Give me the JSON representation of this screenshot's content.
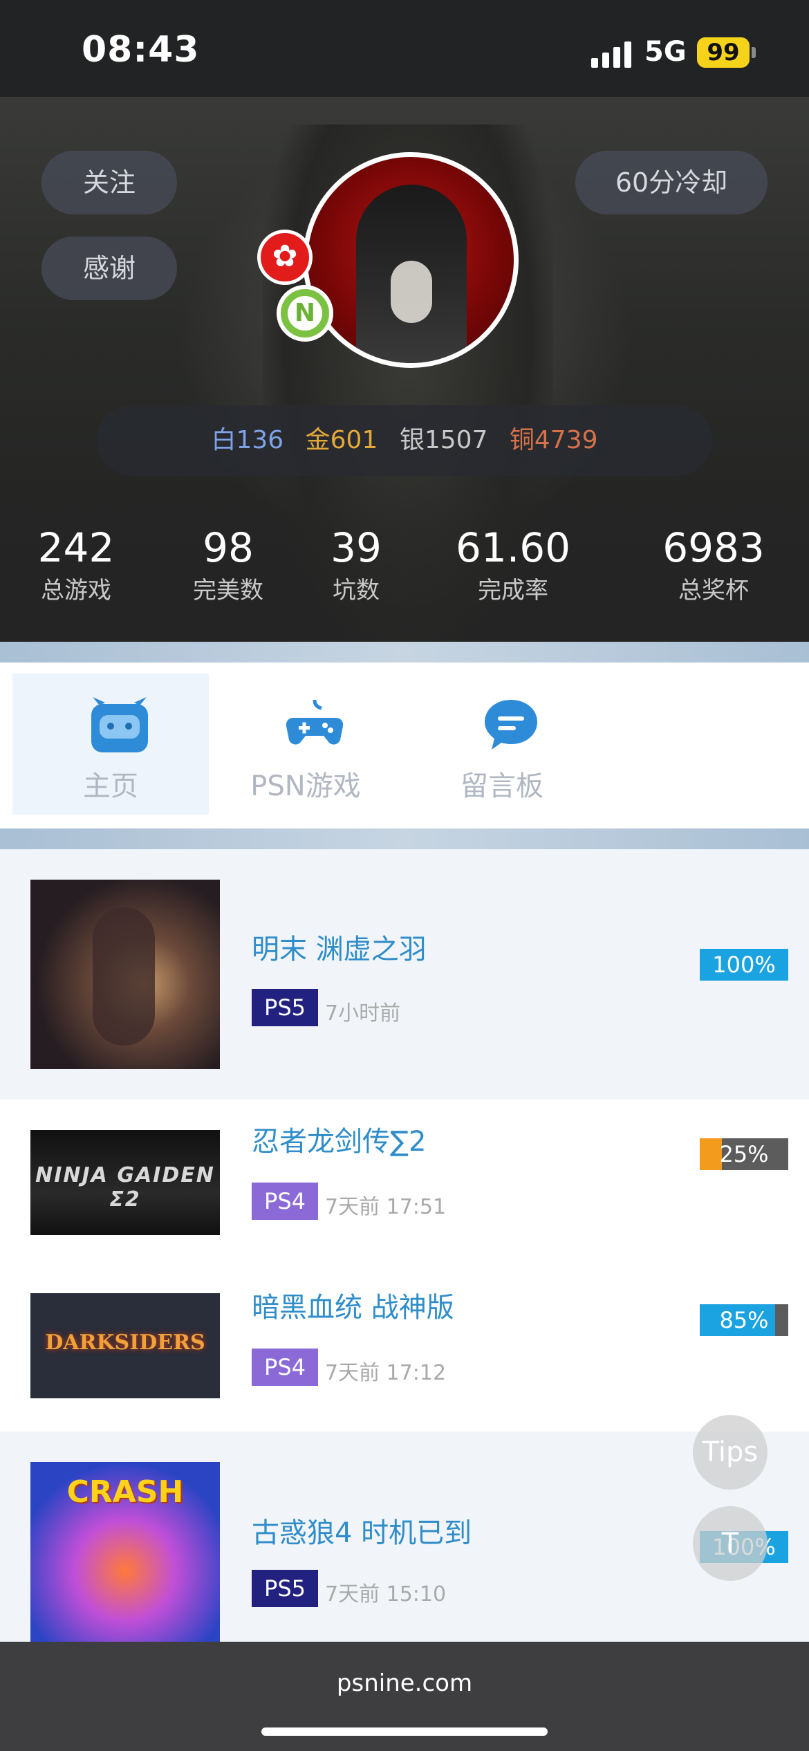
{
  "status": {
    "time": "08:43",
    "network": "5G",
    "battery": "99"
  },
  "profile": {
    "follow_label": "关注",
    "thanks_label": "感谢",
    "cooldown_label": "60分冷却",
    "region_badge": "✿",
    "level_badge": "N",
    "trophies": {
      "platinum": "白136",
      "gold": "金601",
      "silver": "银1507",
      "bronze": "铜4739"
    },
    "stats": [
      {
        "value": "242",
        "label": "总游戏"
      },
      {
        "value": "98",
        "label": "完美数"
      },
      {
        "value": "39",
        "label": "坑数"
      },
      {
        "value": "61.60",
        "label": "完成率"
      },
      {
        "value": "6983",
        "label": "总奖杯"
      }
    ]
  },
  "tabs": [
    {
      "label": "主页",
      "icon": "home-face-icon",
      "active": true
    },
    {
      "label": "PSN游戏",
      "icon": "gamepad-icon",
      "active": false
    },
    {
      "label": "留言板",
      "icon": "message-board-icon",
      "active": false
    }
  ],
  "games": [
    {
      "title": "明末 渊虚之羽",
      "platform": "PS5",
      "time": "7小时前",
      "progress": 100,
      "progress_text": "100%",
      "bar_color": "#1aa3e0",
      "thumb_text": ""
    },
    {
      "title": "忍者龙剑传∑2",
      "platform": "PS4",
      "time": "7天前 17:51",
      "progress": 25,
      "progress_text": "25%",
      "bar_color": "#f39b1d",
      "thumb_text": "NINJA GAIDEN Σ2"
    },
    {
      "title": "暗黑血统 战神版",
      "platform": "PS4",
      "time": "7天前 17:12",
      "progress": 85,
      "progress_text": "85%",
      "bar_color": "#1aa3e0",
      "thumb_text": "DARKSIDERS"
    },
    {
      "title": "古惑狼4 时机已到",
      "platform": "PS5",
      "time": "7天前 15:10",
      "progress": 100,
      "progress_text": "100%",
      "bar_color": "#1aa3e0",
      "thumb_text": "CRASH"
    }
  ],
  "floating": {
    "tips_label": "Tips",
    "top_label": "T"
  },
  "footer": {
    "domain": "psnine.com"
  },
  "colors": {
    "accent": "#2f8dc9",
    "ps5": "#232180",
    "ps4": "#8b6ad8"
  }
}
